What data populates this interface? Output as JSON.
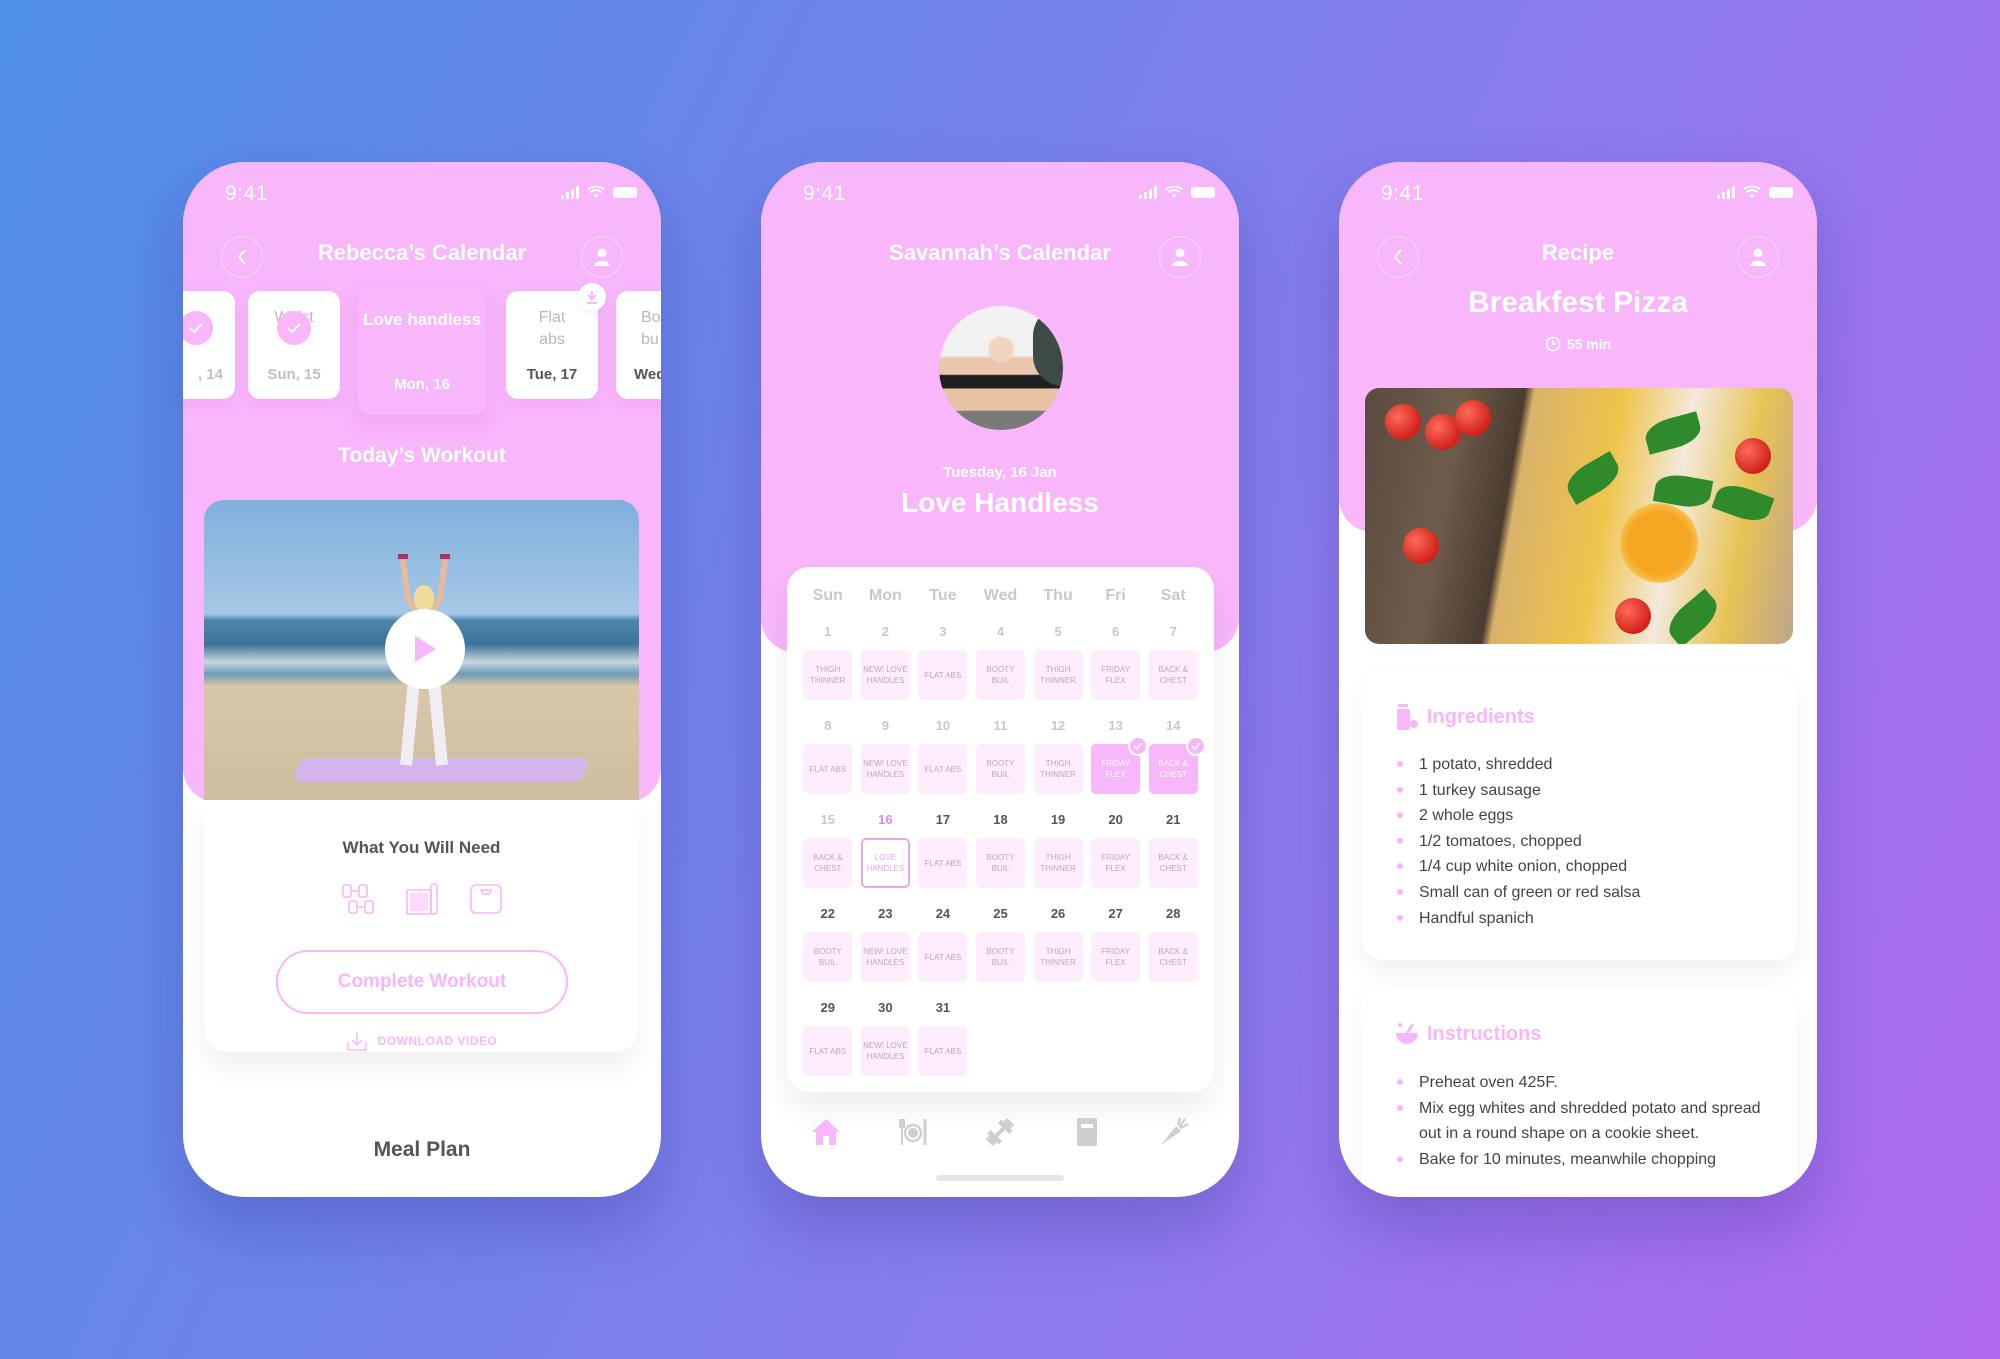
{
  "colors": {
    "accent": "#f8b6fb",
    "tile": "#fdedfd",
    "text_dark": "#555555",
    "text_muted": "#c8c8c8"
  },
  "status_bar": {
    "time": "9:41"
  },
  "phone1": {
    "nav_title": "Rebecca’s Calendar",
    "back_icon": "chevron-left-icon",
    "profile_icon": "user-icon",
    "days": [
      {
        "workout": "",
        "date": ", 14",
        "state": "completed"
      },
      {
        "workout": "Waist",
        "date": "Sun, 15",
        "state": "completed"
      },
      {
        "workout": "Love handless",
        "date": "Mon, 16",
        "state": "active"
      },
      {
        "workout": "Flat abs",
        "date": "Tue, 17",
        "state": "downloadable"
      },
      {
        "workout": "Bo bu",
        "date": "Wed",
        "state": "future"
      }
    ],
    "section_title": "Today’s Workout",
    "need_title": "What You Will Need",
    "equipment": [
      "dumbbells-icon",
      "yoga-mat-icon",
      "scale-icon"
    ],
    "complete_button": "Complete Workout",
    "download_label": "DOWNLOAD VIDEO",
    "meal_plan_title": "Meal Plan"
  },
  "phone2": {
    "nav_title": "Savannah’s Calendar",
    "date_label": "Tuesday, 16 Jan",
    "workout_title": "Love Handless",
    "weekdays": [
      "Sun",
      "Mon",
      "Tue",
      "Wed",
      "Thu",
      "Fri",
      "Sat"
    ],
    "days": [
      {
        "day": "1",
        "label": "THIGH THINNER",
        "state": "past"
      },
      {
        "day": "2",
        "label": "NEW! LOVE HANDLES",
        "state": "past"
      },
      {
        "day": "3",
        "label": "FLAT ABS",
        "state": "past"
      },
      {
        "day": "4",
        "label": "BOOTY BUIL",
        "state": "past"
      },
      {
        "day": "5",
        "label": "THIGH THINNER",
        "state": "past"
      },
      {
        "day": "6",
        "label": "FRIDAY FLEX",
        "state": "past"
      },
      {
        "day": "7",
        "label": "BACK & CHEST",
        "state": "past"
      },
      {
        "day": "8",
        "label": "FLAT ABS",
        "state": "past"
      },
      {
        "day": "9",
        "label": "NEW! LOVE HANDLES",
        "state": "past"
      },
      {
        "day": "10",
        "label": "FLAT ABS",
        "state": "past"
      },
      {
        "day": "11",
        "label": "BOOTY BUIL",
        "state": "past"
      },
      {
        "day": "12",
        "label": "THIGH THINNER",
        "state": "past"
      },
      {
        "day": "13",
        "label": "FRIDAY FLEX",
        "state": "done"
      },
      {
        "day": "14",
        "label": "BACK & CHEST",
        "state": "done"
      },
      {
        "day": "15",
        "label": "BACK & CHEST",
        "state": "past"
      },
      {
        "day": "16",
        "label": "LOVE HANDLES",
        "state": "today"
      },
      {
        "day": "17",
        "label": "FLAT ABS",
        "state": "upcoming"
      },
      {
        "day": "18",
        "label": "BOOTY BUIL",
        "state": "upcoming"
      },
      {
        "day": "19",
        "label": "THIGH THINNER",
        "state": "upcoming"
      },
      {
        "day": "20",
        "label": "FRIDAY FLEX",
        "state": "upcoming"
      },
      {
        "day": "21",
        "label": "BACK & CHEST",
        "state": "upcoming"
      },
      {
        "day": "22",
        "label": "BOOTY BUIL",
        "state": "upcoming"
      },
      {
        "day": "23",
        "label": "NEW! LOVE HANDLES",
        "state": "upcoming"
      },
      {
        "day": "24",
        "label": "FLAT ABS",
        "state": "upcoming"
      },
      {
        "day": "25",
        "label": "BOOTY BUIL",
        "state": "upcoming"
      },
      {
        "day": "26",
        "label": "THIGH THINNER",
        "state": "upcoming"
      },
      {
        "day": "27",
        "label": "FRIDAY FLEX",
        "state": "upcoming"
      },
      {
        "day": "28",
        "label": "BACK & CHEST",
        "state": "upcoming"
      },
      {
        "day": "29",
        "label": "FLAT ABS",
        "state": "upcoming"
      },
      {
        "day": "30",
        "label": "NEW! LOVE HANDLES",
        "state": "upcoming"
      },
      {
        "day": "31",
        "label": "FLAT ABS",
        "state": "upcoming"
      }
    ],
    "tabbar": [
      {
        "icon": "home-icon",
        "active": true
      },
      {
        "icon": "meal-plate-icon",
        "active": false
      },
      {
        "icon": "dumbbell-icon",
        "active": false
      },
      {
        "icon": "book-icon",
        "active": false
      },
      {
        "icon": "carrot-icon",
        "active": false
      }
    ]
  },
  "phone3": {
    "nav_title": "Recipe",
    "recipe_title": "Breakfest Pizza",
    "duration": "55 min",
    "ingredients_title": "Ingredients",
    "ingredients": [
      "1 potato, shredded",
      "1 turkey sausage",
      "2 whole eggs",
      "1/2 tomatoes, chopped",
      "1/4 cup white onion, chopped",
      "Small can of green or red salsa",
      "Handful spanich"
    ],
    "instructions_title": "Instructions",
    "instructions": [
      "Preheat oven 425F.",
      "Mix egg whites and shredded potato and spread out in a round shape on a cookie sheet.",
      "Bake for 10 minutes, meanwhile chopping"
    ]
  }
}
